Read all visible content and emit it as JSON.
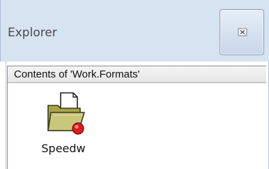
{
  "window": {
    "title": "Explorer",
    "close_icon": "close-icon"
  },
  "panel": {
    "header": "Contents of 'Work.Formats'",
    "items": [
      {
        "label": "Speedw",
        "icon": "format-catalog-icon"
      }
    ]
  }
}
